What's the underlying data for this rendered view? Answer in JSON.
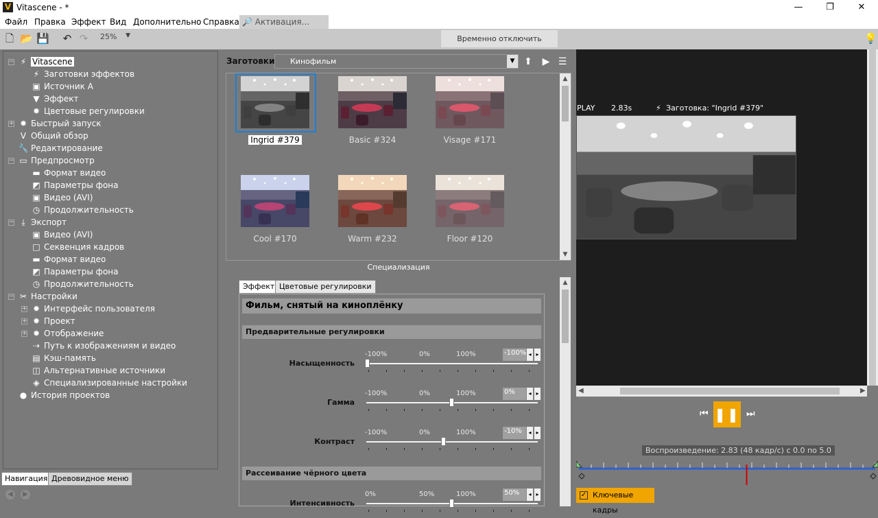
{
  "window": {
    "title": "Vitascene - *",
    "logo": "V",
    "min": "—",
    "max": "❐",
    "close": "✕"
  },
  "menu": [
    "Файл",
    "Правка",
    "Эффект",
    "Вид",
    "Дополнительно",
    "Справка"
  ],
  "activation": "Активация...",
  "toolbar": {
    "zoom": "25%",
    "disable_effect": "Временно отключить эффект"
  },
  "tree": {
    "items": [
      {
        "label": "Vitascene",
        "icon": "lightning-icon"
      },
      {
        "label": "Заготовки эффектов",
        "icon": "lightning-icon"
      },
      {
        "label": "Источник A",
        "icon": "source-icon"
      },
      {
        "label": "Эффект",
        "icon": "filter-icon"
      },
      {
        "label": "Цветовые регулировки",
        "icon": "sun-icon"
      },
      {
        "label": "Быстрый запуск",
        "icon": "sun-icon"
      },
      {
        "label": "Общий обзор",
        "icon": "overview-icon"
      },
      {
        "label": "Редактирование",
        "icon": "wrench-icon"
      },
      {
        "label": "Предпросмотр",
        "icon": "monitor-icon"
      },
      {
        "label": "Формат видео",
        "icon": "film-icon"
      },
      {
        "label": "Параметры фона",
        "icon": "background-icon"
      },
      {
        "label": "Видео (AVI)",
        "icon": "source-icon"
      },
      {
        "label": "Продолжительность",
        "icon": "clock-icon"
      },
      {
        "label": "Экспорт",
        "icon": "download-icon"
      },
      {
        "label": "Видео (AVI)",
        "icon": "source-icon"
      },
      {
        "label": "Секвенция кадров",
        "icon": "frame-icon"
      },
      {
        "label": "Формат видео",
        "icon": "film-icon"
      },
      {
        "label": "Параметры фона",
        "icon": "background-icon"
      },
      {
        "label": "Продолжительность",
        "icon": "clock-icon"
      },
      {
        "label": "Настройки",
        "icon": "tools-icon"
      },
      {
        "label": "Интерфейс пользователя",
        "icon": "sun-icon"
      },
      {
        "label": "Проект",
        "icon": "sun-icon"
      },
      {
        "label": "Отображение",
        "icon": "sun-icon"
      },
      {
        "label": "Путь к изображениям и видео",
        "icon": "path-icon"
      },
      {
        "label": "Кэш-память",
        "icon": "cache-icon"
      },
      {
        "label": "Альтернативные источники",
        "icon": "alt-source-icon"
      },
      {
        "label": "Специализированные настройки",
        "icon": "special-icon"
      },
      {
        "label": "История проектов",
        "icon": "balloon-icon"
      }
    ]
  },
  "bottom_tabs": [
    "Навигация",
    "Древовидное меню"
  ],
  "presets": {
    "label": "Заготовки",
    "selected": "Кинофильм",
    "thumbs": [
      "Ingrid #379",
      "Basic #324",
      "Visage #171",
      "Cool #170",
      "Warm #232",
      "Floor #120"
    ]
  },
  "specialization": "Специализация",
  "props": {
    "tabs": [
      "Эффект",
      "Цветовые регулировки"
    ],
    "title": "Фильм, снятый на киноплёнку",
    "section1": "Предварительные регулировки",
    "section2": "Рассеивание чёрного цвета",
    "sliders": [
      {
        "label": "Насыщенность",
        "min": "-100%",
        "mid": "0%",
        "max": "100%",
        "value": "-100%",
        "level": -100
      },
      {
        "label": "Гамма",
        "min": "-100%",
        "mid": "0%",
        "max": "100%",
        "value": "0%",
        "level": 0
      },
      {
        "label": "Контраст",
        "min": "-100%",
        "mid": "0%",
        "max": "100%",
        "value": "-10%",
        "level": -10
      },
      {
        "label": "Интенсивность",
        "min": "0%",
        "mid": "50%",
        "max": "100%",
        "value": "50%",
        "level": 50
      }
    ]
  },
  "viewer": {
    "mode": "PLAY",
    "time": "2.83s",
    "preset": "Заготовка: \"Ingrid #379\""
  },
  "playback": {
    "info": "Воспроизведение: 2.83 (48 кадр/с) с 0.0 по 5.0",
    "position": 2.83,
    "start": 0.0,
    "end": 5.0
  },
  "keyframes": "Ключевые кадры"
}
